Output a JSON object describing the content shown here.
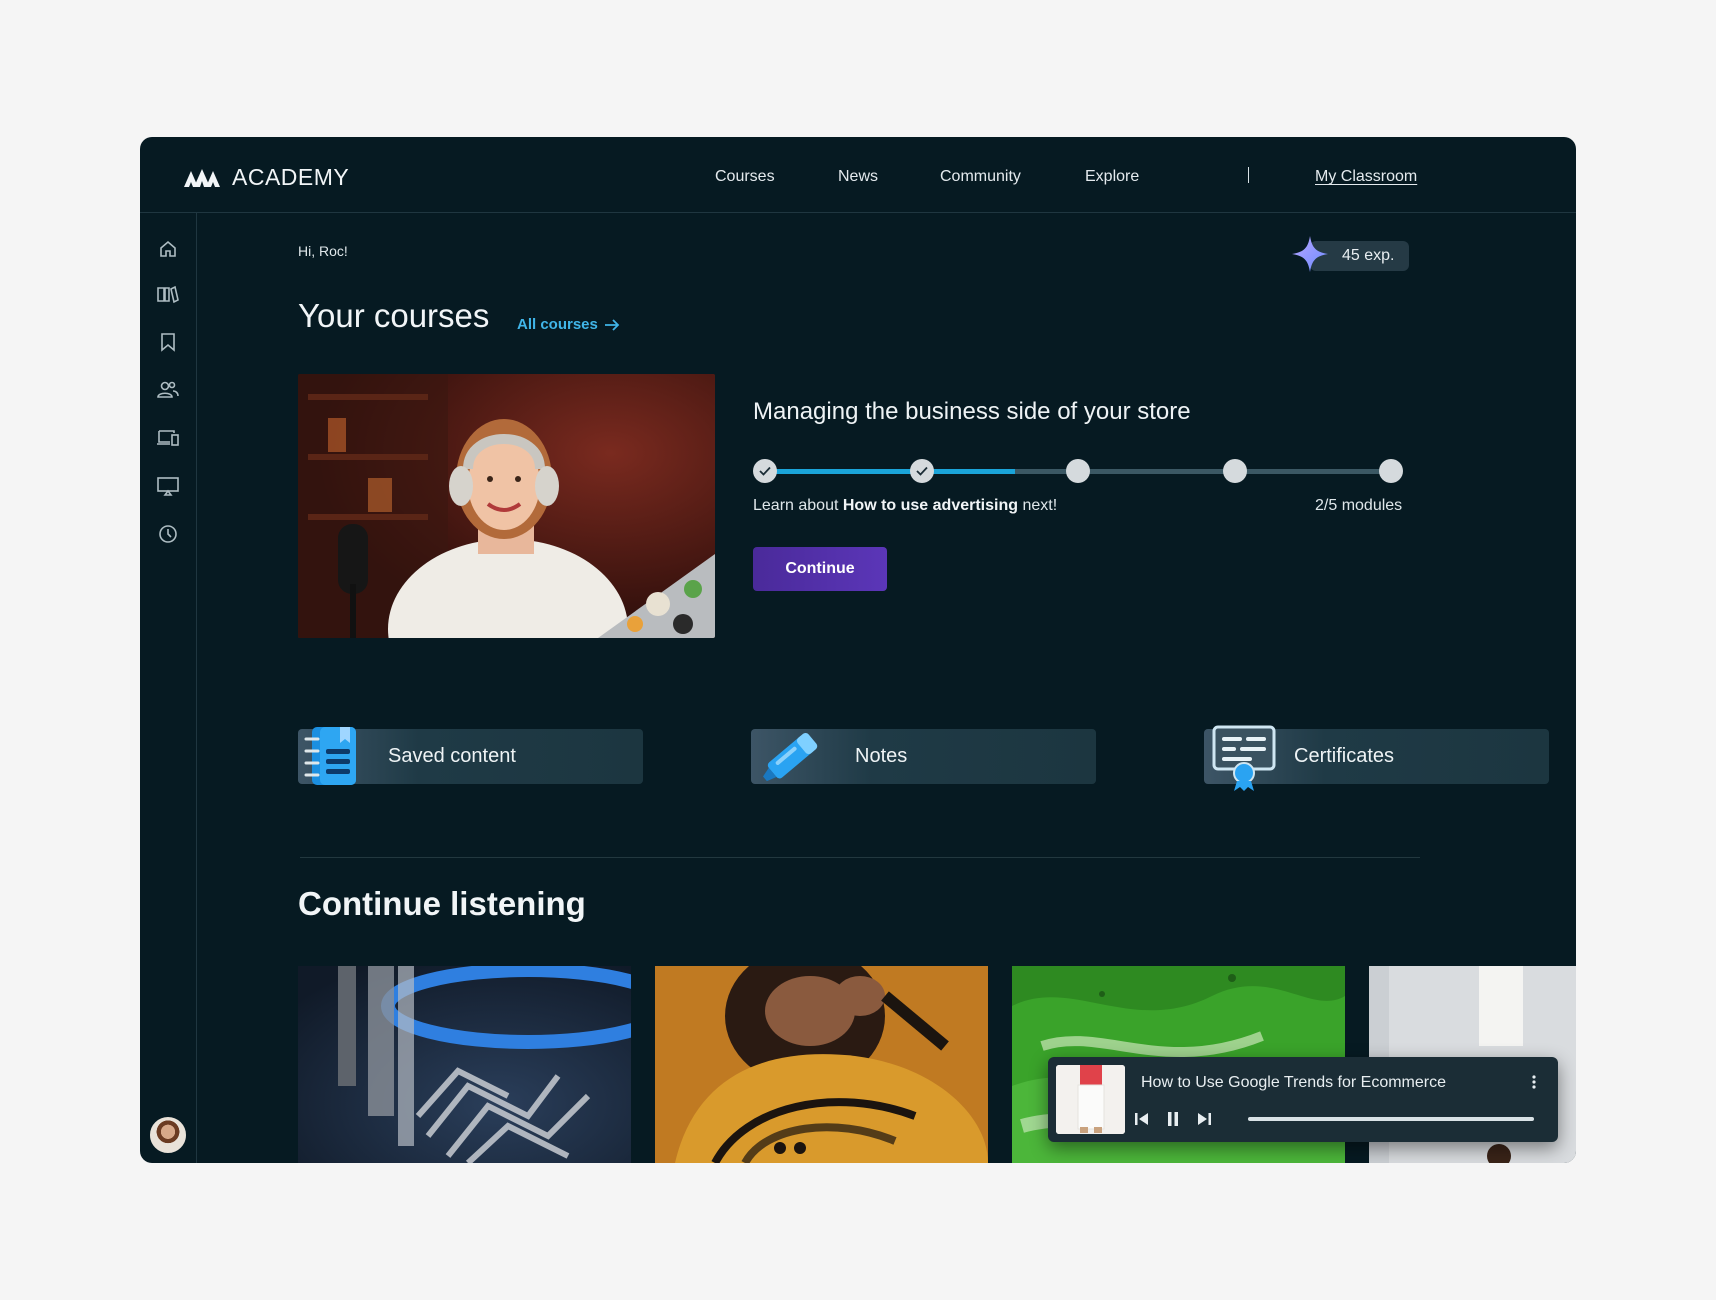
{
  "brand": {
    "name": "ACADEMY"
  },
  "nav": {
    "links": [
      "Courses",
      "News",
      "Community",
      "Explore"
    ],
    "my_classroom": "My Classroom"
  },
  "sidebar": {
    "icons": [
      "home-icon",
      "library-icon",
      "bookmark-icon",
      "people-icon",
      "devices-icon",
      "screen-icon",
      "history-icon"
    ]
  },
  "greeting": "Hi, Roc!",
  "exp": {
    "label": "45 exp."
  },
  "courses": {
    "heading": "Your courses",
    "all_label": "All courses",
    "current": {
      "title": "Managing the business side of your store",
      "learn_prefix": "Learn about ",
      "learn_topic": "How to use advertising",
      "learn_suffix": " next!",
      "modules_label": "2/5 modules",
      "modules_done": 2,
      "modules_total": 5,
      "progress_fraction": 0.4,
      "continue_label": "Continue"
    }
  },
  "quick_links": [
    {
      "label": "Saved content",
      "icon": "notebook-icon"
    },
    {
      "label": "Notes",
      "icon": "highlighter-icon"
    },
    {
      "label": "Certificates",
      "icon": "certificate-icon"
    }
  ],
  "listening": {
    "heading": "Continue listening",
    "player": {
      "title": "How to Use Google Trends for Ecommerce",
      "progress_fraction": 0.0
    }
  },
  "colors": {
    "app_bg": "#061a22",
    "accent_blue": "#40b5e8",
    "progress_fill": "#1aa4d9",
    "button_purple": "#5b36b8"
  }
}
